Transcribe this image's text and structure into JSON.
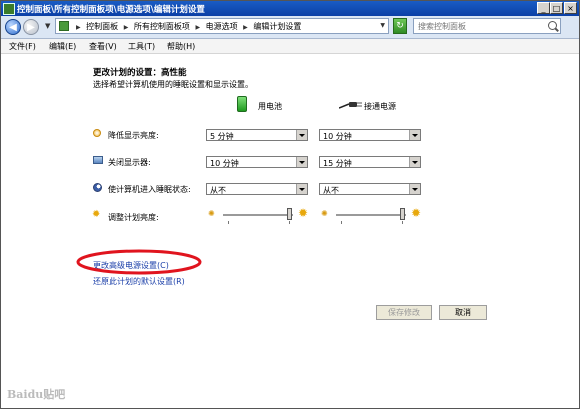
{
  "window": {
    "title": "控制面板\\所有控制面板项\\电源选项\\编辑计划设置",
    "min_label": "_",
    "max_label": "□",
    "close_label": "×"
  },
  "address_bar": {
    "back_label": "◀",
    "forward_label": "▶",
    "breadcrumbs": [
      "控制面板",
      "所有控制面板项",
      "电源选项",
      "编辑计划设置"
    ],
    "search_placeholder": "搜索控制面板"
  },
  "menu": {
    "items": [
      "文件(F)",
      "编辑(E)",
      "查看(V)",
      "工具(T)",
      "帮助(H)"
    ]
  },
  "plan": {
    "heading": "更改计划的设置：高性能",
    "description": "选择希望计算机使用的睡眠设置和显示设置。",
    "battery_label": "用电池",
    "plugged_label": "接通电源"
  },
  "settings": [
    {
      "label": "降低显示亮度:",
      "icon": "dim-display-icon",
      "battery": "5 分钟",
      "plugged": "10 分钟"
    },
    {
      "label": "关闭显示器:",
      "icon": "monitor-icon",
      "battery": "10 分钟",
      "plugged": "15 分钟"
    },
    {
      "label": "使计算机进入睡眠状态:",
      "icon": "sleep-moon-icon",
      "battery": "从不",
      "plugged": "从不"
    }
  ],
  "brightness": {
    "label": "调整计划亮度:",
    "battery_level": 0.95,
    "plugged_level": 0.95
  },
  "links": {
    "advanced": "更改高级电源设置(C)",
    "restore": "还原此计划的默认设置(R)"
  },
  "buttons": {
    "save": "保存修改",
    "cancel": "取消"
  },
  "watermark": "Baidu贴吧",
  "colors": {
    "highlight_ellipse": "#e0141e",
    "titlebar": "#0b3fa6",
    "link": "#1a3ea8"
  }
}
